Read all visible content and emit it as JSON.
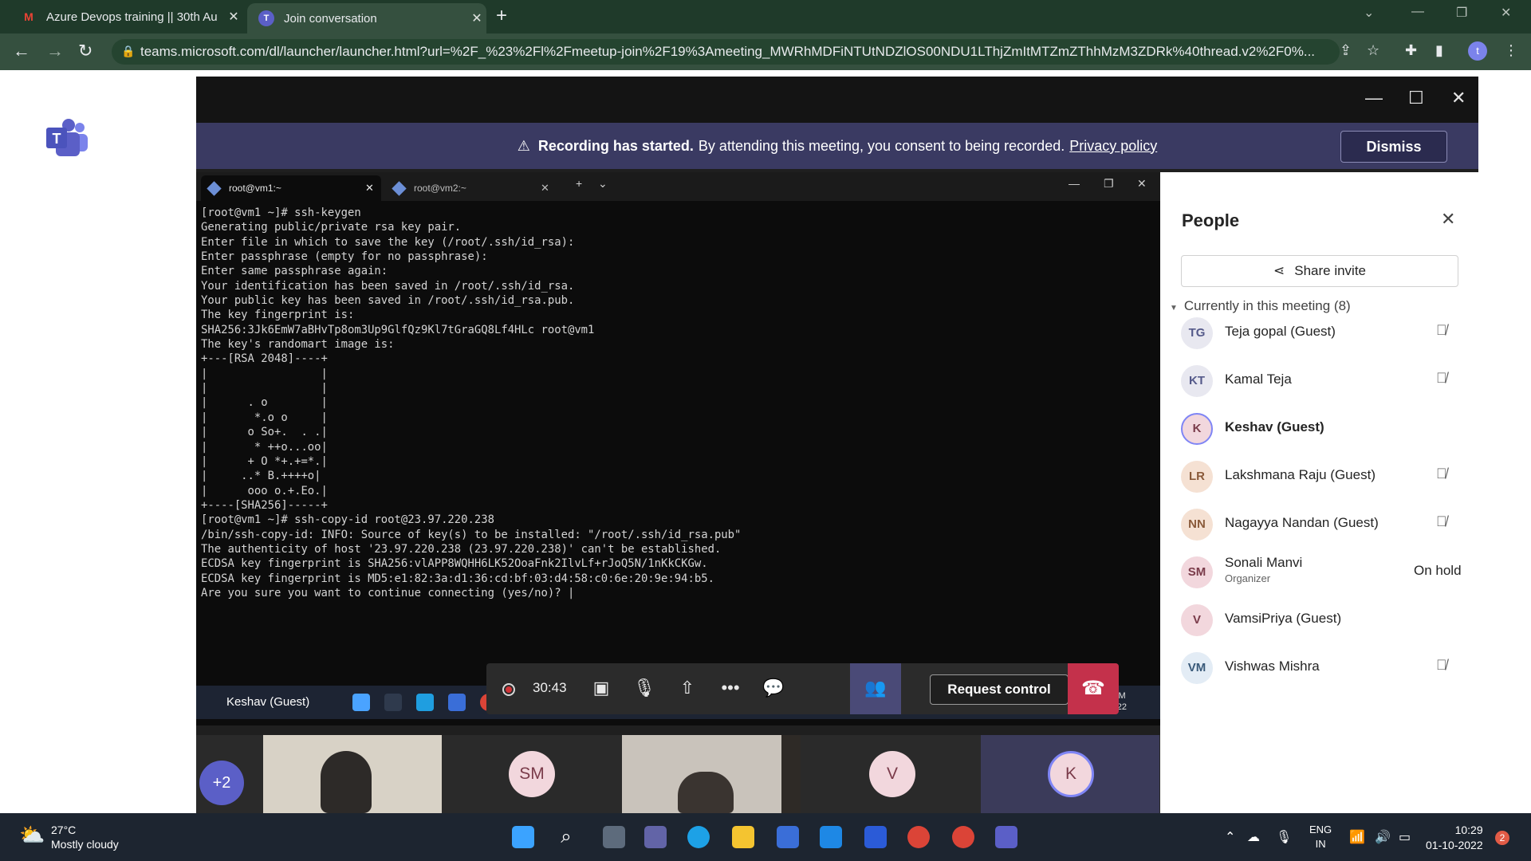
{
  "browser": {
    "tabs": [
      {
        "title": "Azure Devops training || 30th Au",
        "favicon": "gmail-icon"
      },
      {
        "title": "Join conversation",
        "favicon": "teams-icon"
      }
    ],
    "url": "teams.microsoft.com/dl/launcher/launcher.html?url=%2F_%23%2Fl%2Fmeetup-join%2F19%3Ameeting_MWRhMDFiNTUtNDZlOS00NDU1LThjZmItMTZmZThhMzM3ZDRk%40thread.v2%2F0%...",
    "profile_initial": "t"
  },
  "recording_banner": {
    "title": "Recording has started.",
    "message": "By attending this meeting, you consent to being recorded.",
    "link": "Privacy policy",
    "dismiss": "Dismiss"
  },
  "terminal": {
    "tabs": [
      "root@vm1:~",
      "root@vm2:~"
    ],
    "output": "[root@vm1 ~]# ssh-keygen\nGenerating public/private rsa key pair.\nEnter file in which to save the key (/root/.ssh/id_rsa):\nEnter passphrase (empty for no passphrase):\nEnter same passphrase again:\nYour identification has been saved in /root/.ssh/id_rsa.\nYour public key has been saved in /root/.ssh/id_rsa.pub.\nThe key fingerprint is:\nSHA256:3Jk6EmW7aBHvTp8om3Up9GlfQz9Kl7tGraGQ8Lf4HLc root@vm1\nThe key's randomart image is:\n+---[RSA 2048]----+\n|                 |\n|                 |\n|      . o        |\n|       *.o o     |\n|      o So+.  . .|\n|       * ++o...oo|\n|      + O *+.+=*.|\n|     ..* B.++++o|\n|      ooo o.+.Eo.|\n+----[SHA256]-----+\n[root@vm1 ~]# ssh-copy-id root@23.97.220.238\n/bin/ssh-copy-id: INFO: Source of key(s) to be installed: \"/root/.ssh/id_rsa.pub\"\nThe authenticity of host '23.97.220.238 (23.97.220.238)' can't be established.\nECDSA key fingerprint is SHA256:vlAPP8WQHH6LK52OoaFnk2IlvLf+rJoQ5N/1nKkCKGw.\nECDSA key fingerprint is MD5:e1:82:3a:d1:36:cd:bf:03:d4:58:c0:6e:20:9e:94:b5.\nAre you sure you want to continue connecting (yes/no)? |"
  },
  "meeting_controls": {
    "timer": "30:43",
    "request_control": "Request control"
  },
  "presenter_name": "Keshav (Guest)",
  "presenter_clock": {
    "time": "10:29 AM",
    "date": "10/1/2022"
  },
  "video_tiles": {
    "overflow": "+2",
    "avatars": [
      "SM",
      "V",
      "K"
    ]
  },
  "people_panel": {
    "title": "People",
    "share_invite": "Share invite",
    "section": "Currently in this meeting (8)",
    "participants": [
      {
        "initials": "TG",
        "name": "Teja gopal (Guest)",
        "muted": true
      },
      {
        "initials": "KT",
        "name": "Kamal Teja",
        "muted": true
      },
      {
        "initials": "K",
        "name": "Keshav (Guest)",
        "muted": false
      },
      {
        "initials": "LR",
        "name": "Lakshmana Raju (Guest)",
        "muted": true
      },
      {
        "initials": "NN",
        "name": "Nagayya Nandan (Guest)",
        "muted": true
      },
      {
        "initials": "SM",
        "name": "Sonali Manvi",
        "role": "Organizer",
        "status": "On hold"
      },
      {
        "initials": "V",
        "name": "VamsiPriya (Guest)",
        "muted": false
      },
      {
        "initials": "VM",
        "name": "Vishwas Mishra",
        "muted": true
      }
    ]
  },
  "taskbar": {
    "weather_temp": "27°C",
    "weather_desc": "Mostly cloudy",
    "lang": "ENG",
    "region": "IN",
    "time": "10:29",
    "date": "01-10-2022",
    "notifications": "2"
  }
}
